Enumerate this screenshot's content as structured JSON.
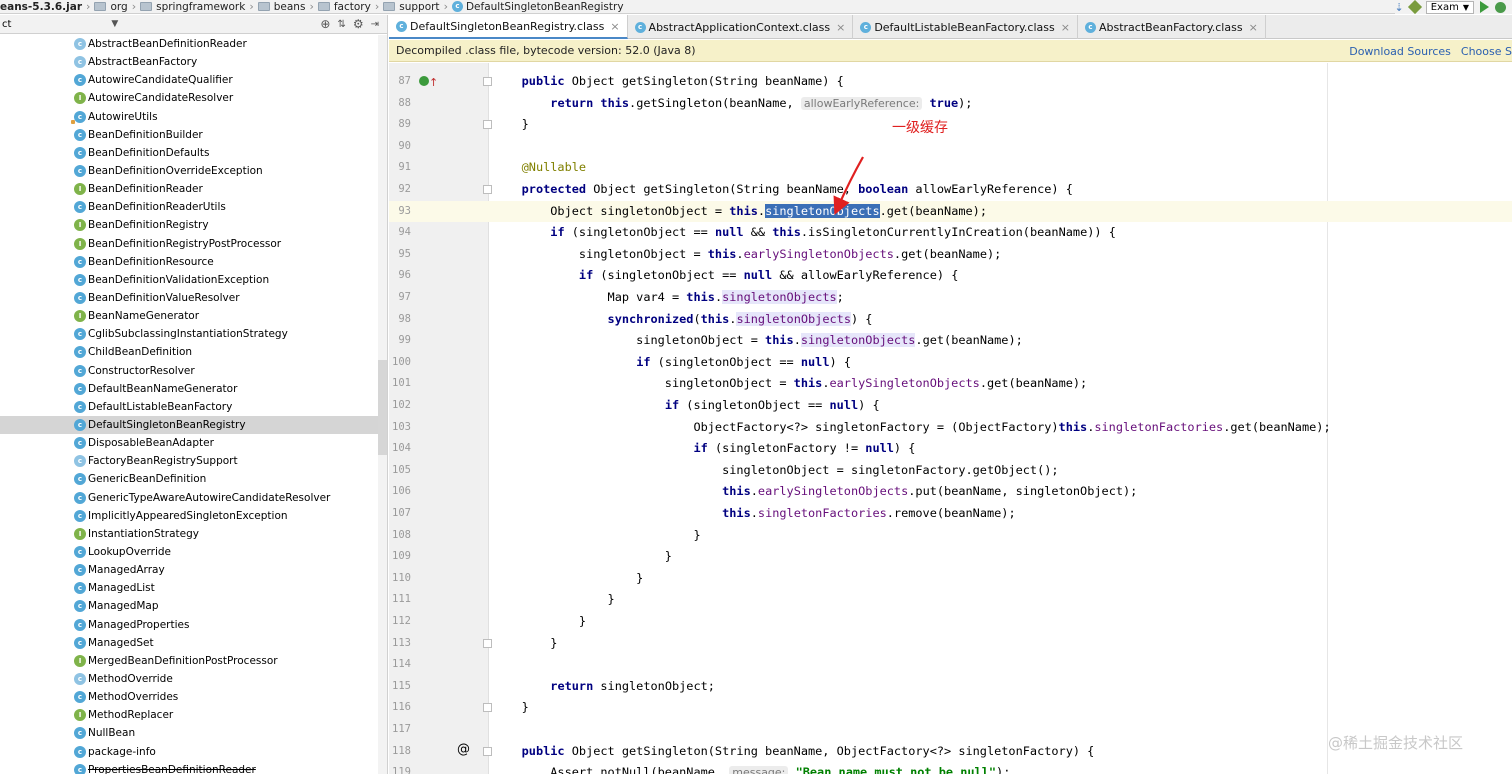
{
  "breadcrumb": [
    {
      "label": "eans-5.3.6.jar",
      "icon": "jar-icon",
      "bold": true
    },
    {
      "label": "org",
      "icon": "folder-icon"
    },
    {
      "label": "springframework",
      "icon": "folder-icon"
    },
    {
      "label": "beans",
      "icon": "folder-icon"
    },
    {
      "label": "factory",
      "icon": "folder-icon"
    },
    {
      "label": "support",
      "icon": "folder-icon"
    },
    {
      "label": "DefaultSingletonBeanRegistry",
      "icon": "class-icon"
    }
  ],
  "run_config": {
    "label": "Exam"
  },
  "project_panel": {
    "header_label": "ct",
    "classes": [
      {
        "name": "AbstractBeanDefinitionReader",
        "kind": "a"
      },
      {
        "name": "AbstractBeanFactory",
        "kind": "a"
      },
      {
        "name": "AutowireCandidateQualifier",
        "kind": "c"
      },
      {
        "name": "AutowireCandidateResolver",
        "kind": "i"
      },
      {
        "name": "AutowireUtils",
        "kind": "c",
        "locked": true
      },
      {
        "name": "BeanDefinitionBuilder",
        "kind": "c"
      },
      {
        "name": "BeanDefinitionDefaults",
        "kind": "c"
      },
      {
        "name": "BeanDefinitionOverrideException",
        "kind": "c"
      },
      {
        "name": "BeanDefinitionReader",
        "kind": "i"
      },
      {
        "name": "BeanDefinitionReaderUtils",
        "kind": "c"
      },
      {
        "name": "BeanDefinitionRegistry",
        "kind": "i"
      },
      {
        "name": "BeanDefinitionRegistryPostProcessor",
        "kind": "i"
      },
      {
        "name": "BeanDefinitionResource",
        "kind": "c"
      },
      {
        "name": "BeanDefinitionValidationException",
        "kind": "c"
      },
      {
        "name": "BeanDefinitionValueResolver",
        "kind": "c"
      },
      {
        "name": "BeanNameGenerator",
        "kind": "i"
      },
      {
        "name": "CglibSubclassingInstantiationStrategy",
        "kind": "c"
      },
      {
        "name": "ChildBeanDefinition",
        "kind": "c"
      },
      {
        "name": "ConstructorResolver",
        "kind": "c"
      },
      {
        "name": "DefaultBeanNameGenerator",
        "kind": "c"
      },
      {
        "name": "DefaultListableBeanFactory",
        "kind": "c"
      },
      {
        "name": "DefaultSingletonBeanRegistry",
        "kind": "c",
        "selected": true
      },
      {
        "name": "DisposableBeanAdapter",
        "kind": "c"
      },
      {
        "name": "FactoryBeanRegistrySupport",
        "kind": "a"
      },
      {
        "name": "GenericBeanDefinition",
        "kind": "c"
      },
      {
        "name": "GenericTypeAwareAutowireCandidateResolver",
        "kind": "c"
      },
      {
        "name": "ImplicitlyAppearedSingletonException",
        "kind": "c"
      },
      {
        "name": "InstantiationStrategy",
        "kind": "i"
      },
      {
        "name": "LookupOverride",
        "kind": "c"
      },
      {
        "name": "ManagedArray",
        "kind": "c"
      },
      {
        "name": "ManagedList",
        "kind": "c"
      },
      {
        "name": "ManagedMap",
        "kind": "c"
      },
      {
        "name": "ManagedProperties",
        "kind": "c"
      },
      {
        "name": "ManagedSet",
        "kind": "c"
      },
      {
        "name": "MergedBeanDefinitionPostProcessor",
        "kind": "i"
      },
      {
        "name": "MethodOverride",
        "kind": "a"
      },
      {
        "name": "MethodOverrides",
        "kind": "c"
      },
      {
        "name": "MethodReplacer",
        "kind": "i"
      },
      {
        "name": "NullBean",
        "kind": "c"
      },
      {
        "name": "package-info",
        "kind": "c"
      },
      {
        "name": "PropertiesBeanDefinitionReader",
        "kind": "c",
        "struck": true
      }
    ]
  },
  "tabs": [
    {
      "label": "DefaultSingletonBeanRegistry.class",
      "active": true
    },
    {
      "label": "AbstractApplicationContext.class"
    },
    {
      "label": "DefaultListableBeanFactory.class"
    },
    {
      "label": "AbstractBeanFactory.class"
    }
  ],
  "notice": {
    "text": "Decompiled .class file, bytecode version: 52.0 (Java 8)",
    "download_sources": "Download Sources",
    "choose_sources": "Choose S"
  },
  "annotation_label": "一级缓存",
  "watermark": "@稀土掘金技术社区",
  "code_lines": [
    {
      "num": "87",
      "segments": [
        [
          "",
          "    "
        ],
        [
          "kw",
          "public"
        ],
        [
          "",
          " Object getSingleton(String beanName) {"
        ]
      ]
    },
    {
      "num": "88",
      "segments": [
        [
          "",
          "        "
        ],
        [
          "kw",
          "return"
        ],
        [
          "",
          " "
        ],
        [
          "kw",
          "this"
        ],
        [
          "",
          ".getSingleton(beanName, "
        ],
        [
          "hint",
          "allowEarlyReference:"
        ],
        [
          "",
          " "
        ],
        [
          "kw",
          "true"
        ],
        [
          "",
          ");"
        ]
      ]
    },
    {
      "num": "89",
      "segments": [
        [
          "",
          "    }"
        ]
      ]
    },
    {
      "num": "90",
      "segments": []
    },
    {
      "num": "91",
      "segments": [
        [
          "",
          "    "
        ],
        [
          "ann",
          "@Nullable"
        ]
      ]
    },
    {
      "num": "92",
      "segments": [
        [
          "",
          "    "
        ],
        [
          "kw",
          "protected"
        ],
        [
          "",
          " Object getSingleton(String beanName, "
        ],
        [
          "kw",
          "boolean"
        ],
        [
          "",
          " allowEarlyReference) {"
        ]
      ]
    },
    {
      "num": "93",
      "segments": [
        [
          "",
          "        Object singletonObject = "
        ],
        [
          "kw",
          "this"
        ],
        [
          "",
          "."
        ],
        [
          "sel",
          "singletonObjects"
        ],
        [
          "",
          ".get(beanName);"
        ]
      ]
    },
    {
      "num": "94",
      "segments": [
        [
          "",
          "        "
        ],
        [
          "kw",
          "if"
        ],
        [
          "",
          " (singletonObject == "
        ],
        [
          "kw",
          "null"
        ],
        [
          "",
          " && "
        ],
        [
          "kw",
          "this"
        ],
        [
          "",
          ".isSingletonCurrentlyInCreation(beanName)) {"
        ]
      ]
    },
    {
      "num": "95",
      "segments": [
        [
          "",
          "            singletonObject = "
        ],
        [
          "kw",
          "this"
        ],
        [
          "",
          "."
        ],
        [
          "fld",
          "earlySingletonObjects"
        ],
        [
          "",
          ".get(beanName);"
        ]
      ]
    },
    {
      "num": "96",
      "segments": [
        [
          "",
          "            "
        ],
        [
          "kw",
          "if"
        ],
        [
          "",
          " (singletonObject == "
        ],
        [
          "kw",
          "null"
        ],
        [
          "",
          " && allowEarlyReference) {"
        ]
      ]
    },
    {
      "num": "97",
      "segments": [
        [
          "",
          "                Map var4 = "
        ],
        [
          "kw",
          "this"
        ],
        [
          "",
          "."
        ],
        [
          "fldhl",
          "singletonObjects"
        ],
        [
          "",
          ";"
        ]
      ]
    },
    {
      "num": "98",
      "segments": [
        [
          "",
          "                "
        ],
        [
          "kw",
          "synchronized"
        ],
        [
          "",
          "("
        ],
        [
          "kw",
          "this"
        ],
        [
          "",
          "."
        ],
        [
          "fldhl",
          "singletonObjects"
        ],
        [
          "",
          ") {"
        ]
      ]
    },
    {
      "num": "99",
      "segments": [
        [
          "",
          "                    singletonObject = "
        ],
        [
          "kw",
          "this"
        ],
        [
          "",
          "."
        ],
        [
          "fldhl",
          "singletonObjects"
        ],
        [
          "",
          ".get(beanName);"
        ]
      ]
    },
    {
      "num": "100",
      "segments": [
        [
          "",
          "                    "
        ],
        [
          "kw",
          "if"
        ],
        [
          "",
          " (singletonObject == "
        ],
        [
          "kw",
          "null"
        ],
        [
          "",
          ") {"
        ]
      ]
    },
    {
      "num": "101",
      "segments": [
        [
          "",
          "                        singletonObject = "
        ],
        [
          "kw",
          "this"
        ],
        [
          "",
          "."
        ],
        [
          "fld",
          "earlySingletonObjects"
        ],
        [
          "",
          ".get(beanName);"
        ]
      ]
    },
    {
      "num": "102",
      "segments": [
        [
          "",
          "                        "
        ],
        [
          "kw",
          "if"
        ],
        [
          "",
          " (singletonObject == "
        ],
        [
          "kw",
          "null"
        ],
        [
          "",
          ") {"
        ]
      ]
    },
    {
      "num": "103",
      "segments": [
        [
          "",
          "                            ObjectFactory<?> singletonFactory = (ObjectFactory)"
        ],
        [
          "kw",
          "this"
        ],
        [
          "",
          "."
        ],
        [
          "fld",
          "singletonFactories"
        ],
        [
          "",
          ".get(beanName);"
        ]
      ]
    },
    {
      "num": "104",
      "segments": [
        [
          "",
          "                            "
        ],
        [
          "kw",
          "if"
        ],
        [
          "",
          " (singletonFactory != "
        ],
        [
          "kw",
          "null"
        ],
        [
          "",
          ") {"
        ]
      ]
    },
    {
      "num": "105",
      "segments": [
        [
          "",
          "                                singletonObject = singletonFactory.getObject();"
        ]
      ]
    },
    {
      "num": "106",
      "segments": [
        [
          "",
          "                                "
        ],
        [
          "kw",
          "this"
        ],
        [
          "",
          "."
        ],
        [
          "fld",
          "earlySingletonObjects"
        ],
        [
          "",
          ".put(beanName, singletonObject);"
        ]
      ]
    },
    {
      "num": "107",
      "segments": [
        [
          "",
          "                                "
        ],
        [
          "kw",
          "this"
        ],
        [
          "",
          "."
        ],
        [
          "fld",
          "singletonFactories"
        ],
        [
          "",
          ".remove(beanName);"
        ]
      ]
    },
    {
      "num": "108",
      "segments": [
        [
          "",
          "                            }"
        ]
      ]
    },
    {
      "num": "109",
      "segments": [
        [
          "",
          "                        }"
        ]
      ]
    },
    {
      "num": "110",
      "segments": [
        [
          "",
          "                    }"
        ]
      ]
    },
    {
      "num": "111",
      "segments": [
        [
          "",
          "                }"
        ]
      ]
    },
    {
      "num": "112",
      "segments": [
        [
          "",
          "            }"
        ]
      ]
    },
    {
      "num": "113",
      "segments": [
        [
          "",
          "        }"
        ]
      ]
    },
    {
      "num": "114",
      "segments": []
    },
    {
      "num": "115",
      "segments": [
        [
          "",
          "        "
        ],
        [
          "kw",
          "return"
        ],
        [
          "",
          " singletonObject;"
        ]
      ]
    },
    {
      "num": "116",
      "segments": [
        [
          "",
          "    }"
        ]
      ]
    },
    {
      "num": "117",
      "segments": []
    },
    {
      "num": "118",
      "segments": [
        [
          "",
          "    "
        ],
        [
          "kw",
          "public"
        ],
        [
          "",
          " Object getSingleton(String beanName, ObjectFactory<?> singletonFactory) {"
        ]
      ]
    },
    {
      "num": "119",
      "segments": [
        [
          "",
          "        Assert.notNull(beanName, "
        ],
        [
          "hint",
          "message:"
        ],
        [
          "",
          " "
        ],
        [
          "str",
          "\"Bean name must not be null\""
        ],
        [
          "",
          ");"
        ]
      ]
    }
  ]
}
